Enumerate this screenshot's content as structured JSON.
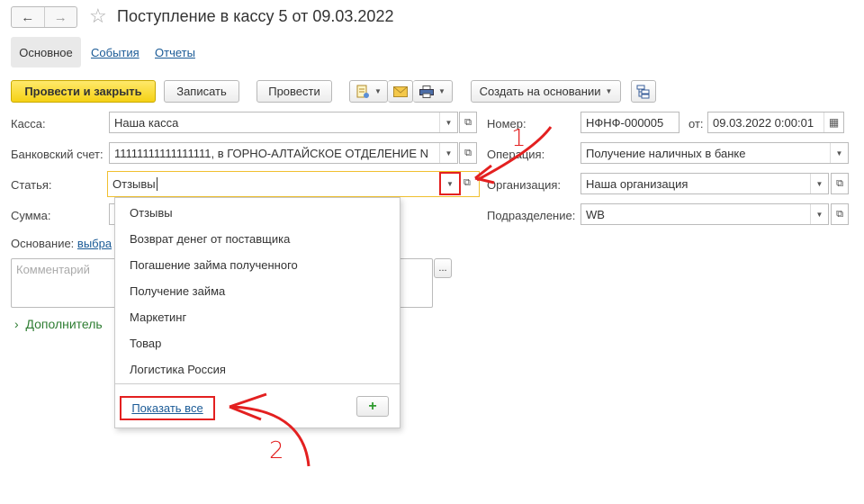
{
  "header": {
    "back_icon": "arrow-left-icon",
    "forward_icon": "arrow-right-icon",
    "favorite_icon": "star-icon",
    "title": "Поступление в кассу 5 от 09.03.2022"
  },
  "tabs": {
    "main": "Основное",
    "events": "События",
    "reports": "Отчеты"
  },
  "toolbar": {
    "post_close": "Провести и закрыть",
    "save": "Записать",
    "post": "Провести",
    "create_based": "Создать на основании"
  },
  "form": {
    "cash_label": "Касса:",
    "cash_value": "Наша касса",
    "bank_label": "Банковский счет:",
    "bank_value": "11111111111111111, в ГОРНО-АЛТАЙСКОЕ ОТДЕЛЕНИЕ N",
    "article_label": "Статья:",
    "article_value": "Отзывы",
    "sum_label": "Сумма:",
    "basis_label": "Основание:",
    "basis_link": "выбра",
    "comment_placeholder": "Комментарий",
    "extra_label": "Дополнитель",
    "number_label": "Номер:",
    "number_value": "НФНФ-000005",
    "date_label": "от:",
    "date_value": "09.03.2022  0:00:01",
    "operation_label": "Операция:",
    "operation_value": "Получение наличных в банке",
    "org_label": "Организация:",
    "org_value": "Наша организация",
    "division_label": "Подразделение:",
    "division_value": "WB"
  },
  "dropdown": {
    "items": [
      "Отзывы",
      "Возврат денег от поставщика",
      "Погашение займа полученного",
      "Получение займа",
      "Маркетинг",
      "Товар",
      "Логистика Россия"
    ],
    "show_all": "Показать все"
  },
  "annotations": {
    "one": "1",
    "two": "2",
    "color": "#e32020"
  }
}
